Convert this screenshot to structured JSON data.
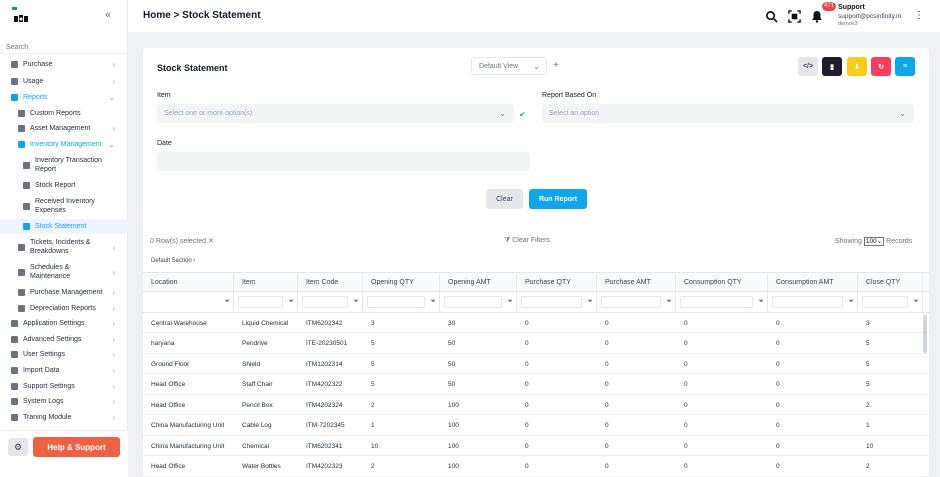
{
  "header": {
    "breadcrumb": "Home > Stock Statement",
    "notification_count": "471",
    "user_name": "Support",
    "user_email": "support@pcsinfinity.in",
    "user_sub": "demov3"
  },
  "sidebar": {
    "search_label": "Search",
    "items": [
      {
        "label": "Purchase",
        "level": 0
      },
      {
        "label": "Usage",
        "level": 0
      },
      {
        "label": "Reports",
        "level": 0
      },
      {
        "label": "Custom Reports",
        "level": 1
      },
      {
        "label": "Asset Management",
        "level": 1
      },
      {
        "label": "Inventory Management",
        "level": 1
      },
      {
        "label": "Inventory Transaction Report",
        "level": 2
      },
      {
        "label": "Stock Report",
        "level": 2
      },
      {
        "label": "Received Inventory Expenses",
        "level": 2
      },
      {
        "label": "Stock Statement",
        "level": 2
      },
      {
        "label": "Tickets, Incidents & Breakdowns",
        "level": 1
      },
      {
        "label": "Schedules & Maintenance",
        "level": 1
      },
      {
        "label": "Purchase Management",
        "level": 1
      },
      {
        "label": "Depreciation Reports",
        "level": 1
      },
      {
        "label": "Application Settings",
        "level": 0
      },
      {
        "label": "Advanced Settings",
        "level": 0
      },
      {
        "label": "User Settings",
        "level": 0
      },
      {
        "label": "Import Data",
        "level": 0
      },
      {
        "label": "Support Settings",
        "level": 0
      },
      {
        "label": "System Logs",
        "level": 0
      },
      {
        "label": "Traning Module",
        "level": 0
      }
    ],
    "help_label": "Help & Support"
  },
  "main": {
    "title": "Stock Statement",
    "view_select": "Default View",
    "item_label": "Item",
    "item_placeholder": "Select one or more option(s)",
    "report_based_label": "Report Based On",
    "report_based_placeholder": "Select an option",
    "date_label": "Date",
    "clear_label": "Clear",
    "run_label": "Run Report",
    "rows_selected": "0 Row(s) selected",
    "clear_filters": "Clear Filters",
    "showing_label": "Showing",
    "showing_value": "100",
    "records_label": "Records",
    "section_label": "Default Section"
  },
  "colors": {
    "accent": "#0ea5e9",
    "help": "#ef6145",
    "tool_dark": "#1e1b2e",
    "tool_yellow": "#facc15",
    "tool_pink": "#f43f5e",
    "tool_blue": "#0ea5e9"
  },
  "table": {
    "columns": [
      "Location",
      "Item",
      "Item Code",
      "Opening QTY",
      "Opening AMT",
      "Purchase QTY",
      "Purchase AMT",
      "Consumption QTY",
      "Consumption AMT",
      "Close QTY"
    ],
    "rows": [
      [
        "Central Warehouse",
        "Liquid Chemical",
        "ITM6202342",
        "3",
        "30",
        "0",
        "0",
        "0",
        "0",
        "3"
      ],
      [
        "haryana",
        "Pendrive",
        "ITE-20230501",
        "5",
        "50",
        "0",
        "0",
        "0",
        "0",
        "5"
      ],
      [
        "Ground Floor",
        "Shield",
        "ITM1202314",
        "5",
        "50",
        "0",
        "0",
        "0",
        "0",
        "5"
      ],
      [
        "Head Office",
        "Staff Chair",
        "ITM4202322",
        "5",
        "50",
        "0",
        "0",
        "0",
        "0",
        "5"
      ],
      [
        "Head Office",
        "Pencil Box",
        "ITM4202324",
        "2",
        "100",
        "0",
        "0",
        "0",
        "0",
        "2"
      ],
      [
        "China Manufacturing Unit",
        "Cable Log",
        "ITM-7202345",
        "1",
        "100",
        "0",
        "0",
        "0",
        "0",
        "1"
      ],
      [
        "China Manufacturing Unit",
        "Chemical",
        "ITM6202341",
        "10",
        "100",
        "0",
        "0",
        "0",
        "0",
        "10"
      ],
      [
        "Head Office",
        "Water Bottles",
        "ITM4202323",
        "2",
        "100",
        "0",
        "0",
        "0",
        "0",
        "2"
      ]
    ]
  }
}
